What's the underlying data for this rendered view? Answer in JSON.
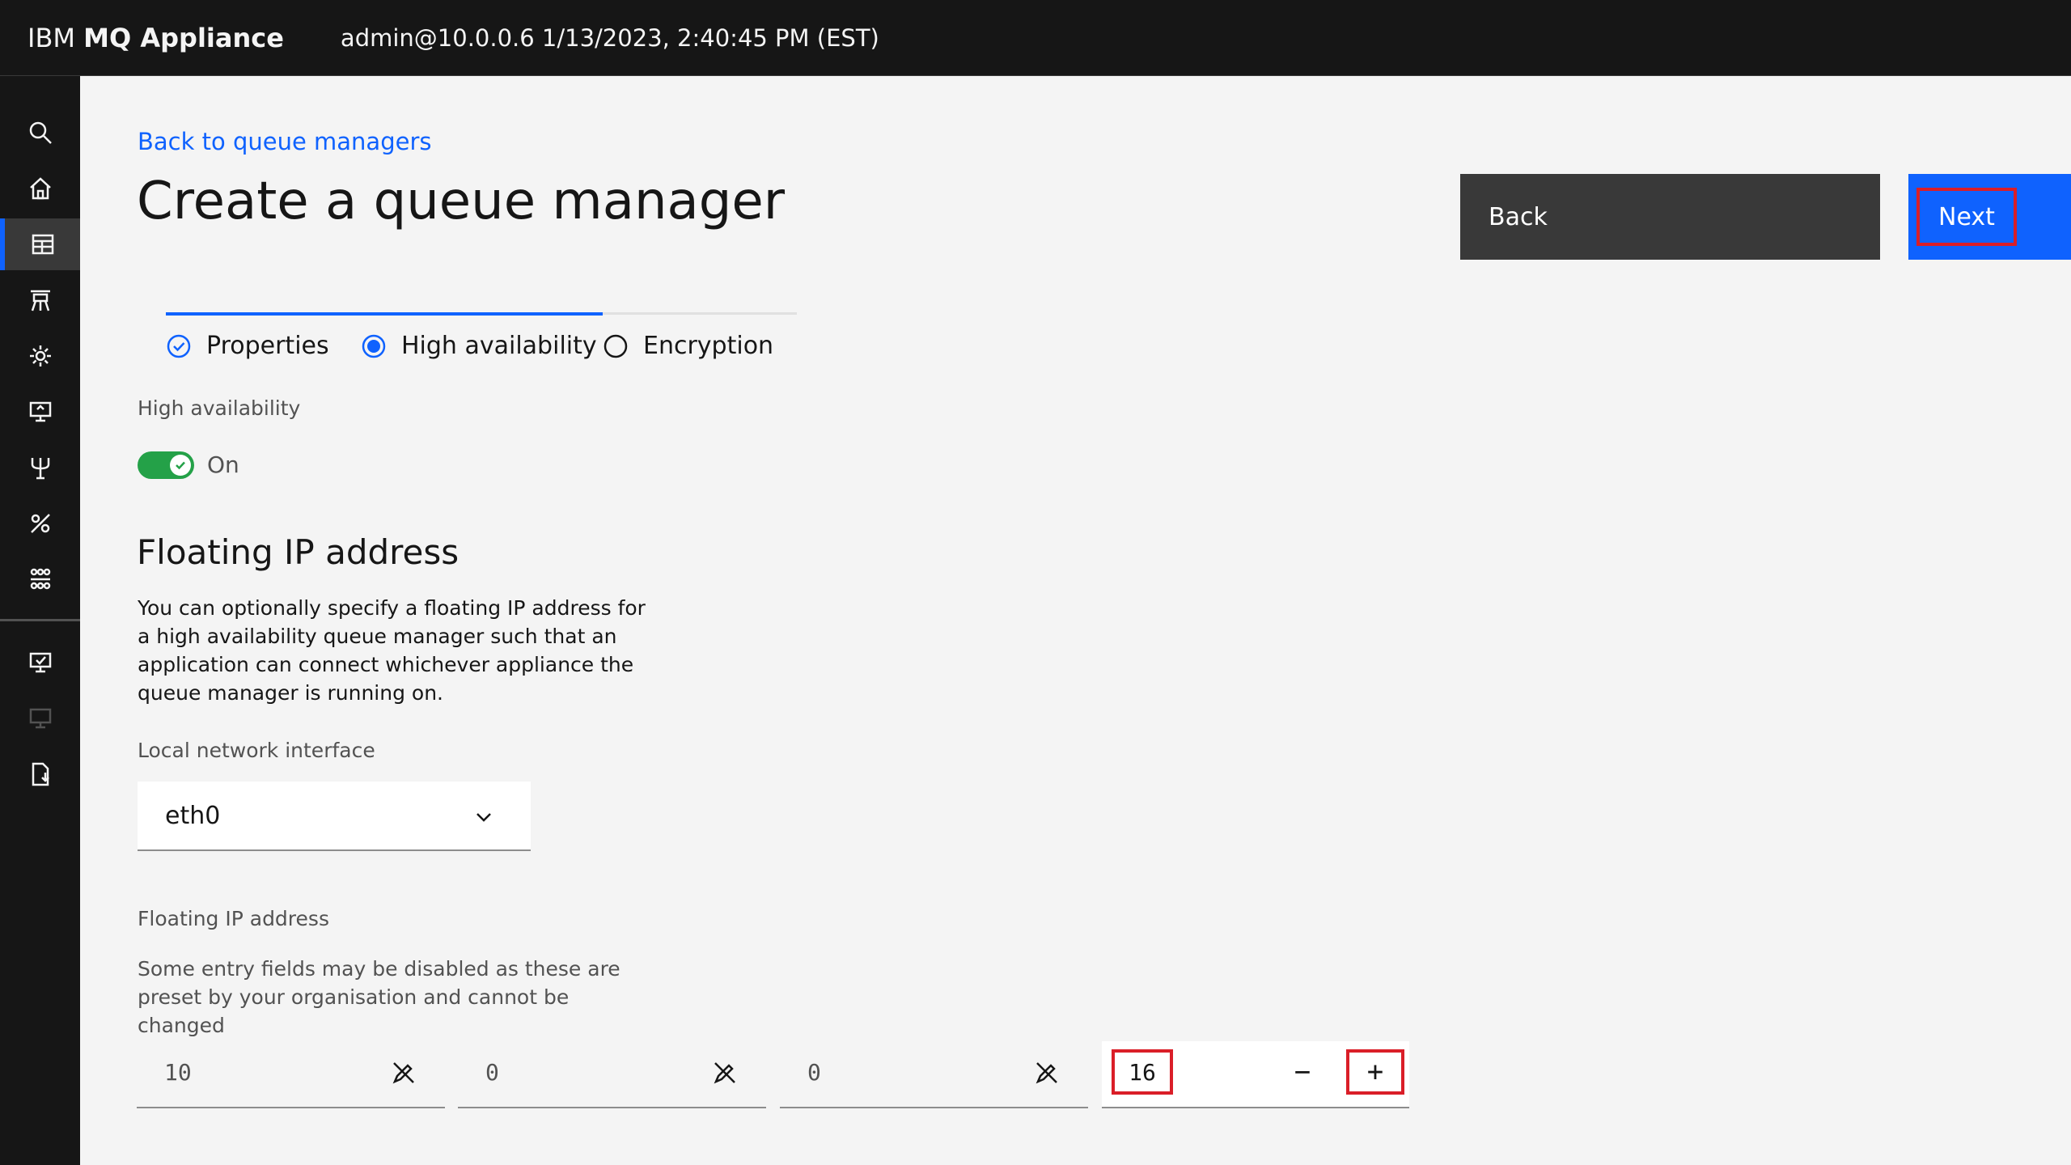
{
  "header": {
    "product_prefix": "IBM ",
    "product_name": "MQ Appliance",
    "session_info": "admin@10.0.0.6 1/13/2023, 2:40:45 PM (EST)"
  },
  "nav": {
    "icons": [
      "search-icon",
      "home-icon",
      "table-icon",
      "messaging-icon",
      "settings-icon",
      "monitor-icon",
      "network-icon",
      "tools-icon",
      "group-icon",
      "status-icon",
      "backup-icon",
      "file-icon"
    ],
    "active_index": 2
  },
  "page": {
    "back_link": "Back to queue managers",
    "title": "Create a queue manager",
    "back_button": "Back",
    "next_button": "Next"
  },
  "steps": [
    {
      "label": "Properties",
      "state": "complete"
    },
    {
      "label": "High availability",
      "state": "current"
    },
    {
      "label": "Encryption",
      "state": "incomplete"
    }
  ],
  "high_availability": {
    "label": "High availability",
    "toggle_state": "On",
    "enabled": true
  },
  "floating_ip": {
    "section_title": "Floating IP address",
    "description": "You can optionally specify a floating IP address for a high availability queue manager such that an application can connect whichever appliance the queue manager is running on.",
    "interface_label": "Local network interface",
    "interface_value": "eth0",
    "address_label": "Floating IP address",
    "address_hint": "Some entry fields may be disabled as these are preset by your organisation and cannot be changed",
    "octets": [
      "10",
      "0",
      "0"
    ],
    "prefix_length": "16",
    "minus": "−",
    "plus": "+"
  },
  "colors": {
    "accent": "#0f62fe",
    "toggle_on": "#24a148",
    "highlight": "#da1e28",
    "topbar": "#161616"
  }
}
